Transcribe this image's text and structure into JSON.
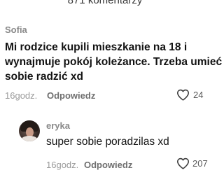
{
  "header": {
    "comments_count": "871 komentarzy"
  },
  "comments": [
    {
      "author": "Sofia",
      "text_lines": [
        "Mi rodzice kupili mieszkanie na 18 i",
        "wynajmuje pokój koleżance. Trzeba umieć",
        "sobie radzić xd"
      ],
      "time": "16godz.",
      "reply_label": "Odpowiedz",
      "likes": "24",
      "like_icon": "heart-outline-icon"
    },
    {
      "author": "eryka",
      "avatar": "avatar-photo",
      "text": "super sobie poradzilas xd",
      "time": "16godz.",
      "reply_label": "Odpowiedz",
      "likes": "207",
      "like_icon": "heart-outline-icon"
    }
  ],
  "colors": {
    "text_primary": "#121212",
    "text_secondary": "#8a8a8a",
    "reply": "#6f6f6f",
    "background": "#ffffff"
  }
}
